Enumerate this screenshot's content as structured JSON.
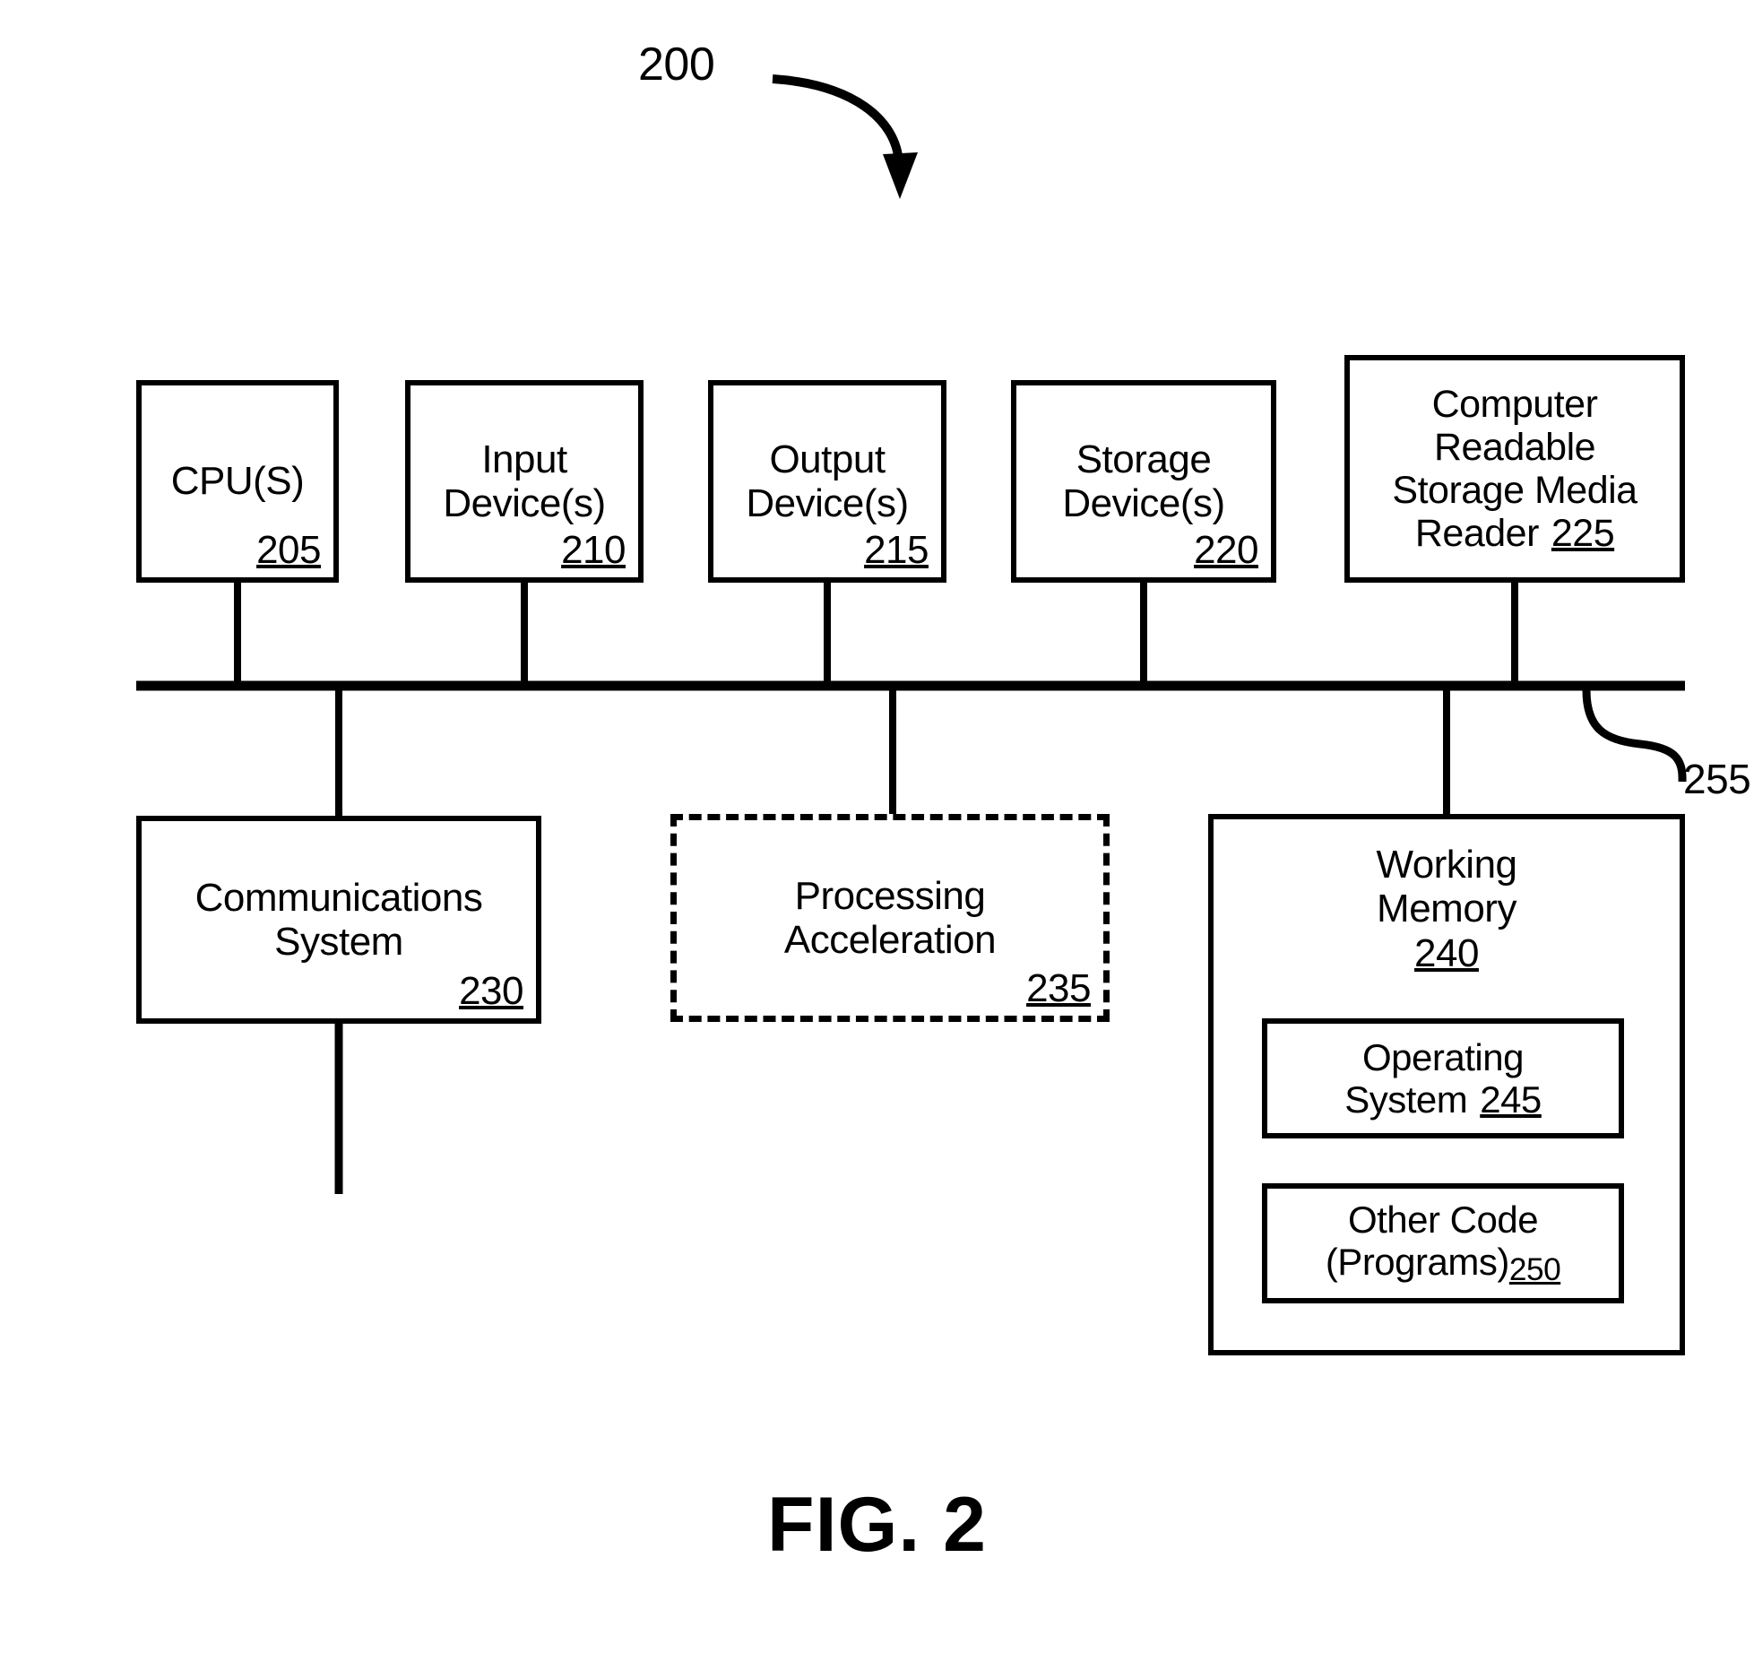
{
  "figure": {
    "caption": "FIG. 2",
    "system_label": "200",
    "bus_label": "255"
  },
  "top_row": [
    {
      "id": "cpu",
      "lines": [
        "CPU(S)"
      ],
      "ref": "205",
      "ref_position": "bottom-right",
      "style": "solid"
    },
    {
      "id": "input",
      "lines": [
        "Input",
        "Device(s)"
      ],
      "ref": "210",
      "ref_position": "bottom-right",
      "style": "solid"
    },
    {
      "id": "output",
      "lines": [
        "Output",
        "Device(s)"
      ],
      "ref": "215",
      "ref_position": "bottom-right",
      "style": "solid"
    },
    {
      "id": "storage",
      "lines": [
        "Storage",
        "Device(s)"
      ],
      "ref": "220",
      "ref_position": "bottom-right",
      "style": "solid"
    },
    {
      "id": "reader",
      "lines": [
        "Computer",
        "Readable",
        "Storage Media",
        "Reader"
      ],
      "ref": "225",
      "ref_position": "inline-last-line",
      "style": "solid"
    }
  ],
  "bottom_row": [
    {
      "id": "comms",
      "lines": [
        "Communications",
        "System"
      ],
      "ref": "230",
      "ref_position": "bottom-right",
      "style": "solid"
    },
    {
      "id": "accel",
      "lines": [
        "Processing",
        "Acceleration"
      ],
      "ref": "235",
      "ref_position": "bottom-right",
      "style": "dashed"
    }
  ],
  "working_memory": {
    "id": "working",
    "lines": [
      "Working",
      "Memory"
    ],
    "ref": "240",
    "ref_position": "centered-below-title",
    "style": "solid",
    "children": [
      {
        "id": "os",
        "lines": [
          "Operating",
          "System"
        ],
        "ref": "245",
        "ref_position": "inline-last-line",
        "style": "solid"
      },
      {
        "id": "other-code",
        "lines": [
          "Other Code",
          "(Programs)"
        ],
        "ref": "250",
        "ref_position": "subscript-last-line",
        "style": "solid"
      }
    ]
  },
  "colors": {
    "line": "#000000",
    "background": "#ffffff"
  }
}
